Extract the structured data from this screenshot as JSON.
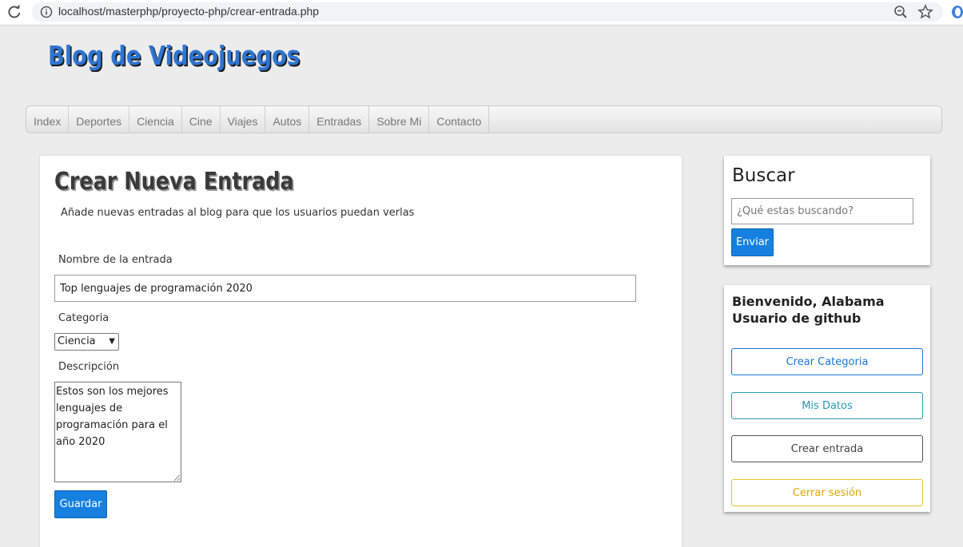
{
  "browser": {
    "url": "localhost/masterphp/proyecto-php/crear-entrada.php"
  },
  "site": {
    "title": "Blog de Videojuegos"
  },
  "nav": {
    "items": [
      "Index",
      "Deportes",
      "Ciencia",
      "Cine",
      "Viajes",
      "Autos",
      "Entradas",
      "Sobre Mi",
      "Contacto"
    ]
  },
  "form": {
    "title": "Crear Nueva Entrada",
    "subtitle": "Añade nuevas entradas al blog para que los usuarios puedan verlas",
    "name_label": "Nombre de la entrada",
    "name_value": "Top lenguajes de programación 2020",
    "category_label": "Categoria",
    "category_value": "Ciencia",
    "description_label": "Descripción",
    "description_value": "Estos son los mejores lenguajes de programación para el año 2020",
    "save_label": "Guardar"
  },
  "search": {
    "title": "Buscar",
    "placeholder": "¿Qué estas buscando?",
    "button_label": "Enviar"
  },
  "user": {
    "welcome": "Bienvenido, Alabama Usuario de github",
    "buttons": [
      "Crear Categoria",
      "Mis Datos",
      "Crear entrada",
      "Cerrar sesión"
    ]
  },
  "colors": {
    "accent_blue": "#1580e0",
    "title_blue": "#2f74d1",
    "teal": "#2a98b0",
    "warning": "#f0c030"
  },
  "icons": [
    "reload-icon",
    "info-icon",
    "zoom-icon",
    "star-icon",
    "extension-icon",
    "chevron-down-icon"
  ]
}
